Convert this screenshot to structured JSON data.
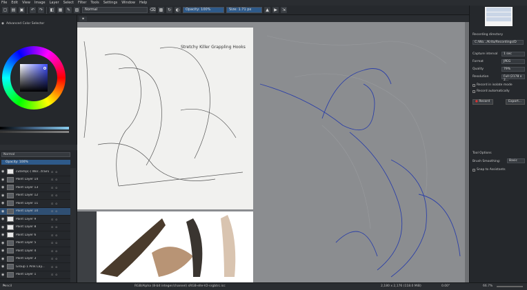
{
  "menu": [
    "File",
    "Edit",
    "View",
    "Image",
    "Layer",
    "Select",
    "Filter",
    "Tools",
    "Settings",
    "Window",
    "Help"
  ],
  "toolbar": {
    "blend_mode": "Normal",
    "opacity": "Opacity: 100%",
    "size": "Size: 1.71 px"
  },
  "color_panel": {
    "title": "Advanced Color Selector"
  },
  "layers_panel": {
    "blend_mode": "Normal",
    "opacity": "Opacity: 100%",
    "layers": [
      {
        "name": "cutemp(-) Wor...trainable1",
        "thumb": "white",
        "selected": false
      },
      {
        "name": "Paint Layer 14",
        "thumb": "grey",
        "selected": false
      },
      {
        "name": "Paint Layer 13",
        "thumb": "grey",
        "selected": false
      },
      {
        "name": "Paint Layer 12",
        "thumb": "grey",
        "selected": false
      },
      {
        "name": "Paint Layer 11",
        "thumb": "grey",
        "selected": false
      },
      {
        "name": "Paint Layer 10",
        "thumb": "grey",
        "selected": true
      },
      {
        "name": "Paint Layer 9",
        "thumb": "white",
        "selected": false
      },
      {
        "name": "Paint Layer 8",
        "thumb": "white",
        "selected": false
      },
      {
        "name": "Paint Layer 6",
        "thumb": "white",
        "selected": false
      },
      {
        "name": "Paint Layer 5",
        "thumb": "grey",
        "selected": false
      },
      {
        "name": "Paint Layer 4",
        "thumb": "grey",
        "selected": false
      },
      {
        "name": "Paint Layer 3",
        "thumb": "grey",
        "selected": false
      },
      {
        "name": "Group 1 Pink Lay...",
        "thumb": "grey",
        "selected": false
      },
      {
        "name": "Paint Layer 1",
        "thumb": "grey",
        "selected": false
      }
    ]
  },
  "recorder": {
    "title": "Recording directory",
    "directory": "C:/Wo.../Krita/Recordings/D",
    "capture_interval_label": "Capture interval",
    "capture_interval": "1 sec",
    "format_label": "Format",
    "format": "JPEG",
    "quality_label": "Quality",
    "quality": "79%",
    "resolution_label": "Resolution",
    "resolution": "Full (2178 x 2...",
    "record_isolate": "Record in isolate mode",
    "record_auto": "Record automatically",
    "record_btn": "Record",
    "export_btn": "Export..."
  },
  "tool_options": {
    "title": "Tool Options",
    "brush_smoothing_label": "Brush Smoothing:",
    "brush_smoothing": "Basic",
    "snap_label": "Snap to Assistants"
  },
  "ref_text": "Stretchy Killer Grappling Hooks",
  "status": {
    "left": "Pencil Sketch",
    "center": "RGB/Alpha (8-bit integer/channel)  sRGB-elle-V2-srgbtrc.icc",
    "right_dims": "2,180 x 2,176 (118.0 MiB)",
    "angle": "0.00°",
    "zoom": "66.7%"
  }
}
